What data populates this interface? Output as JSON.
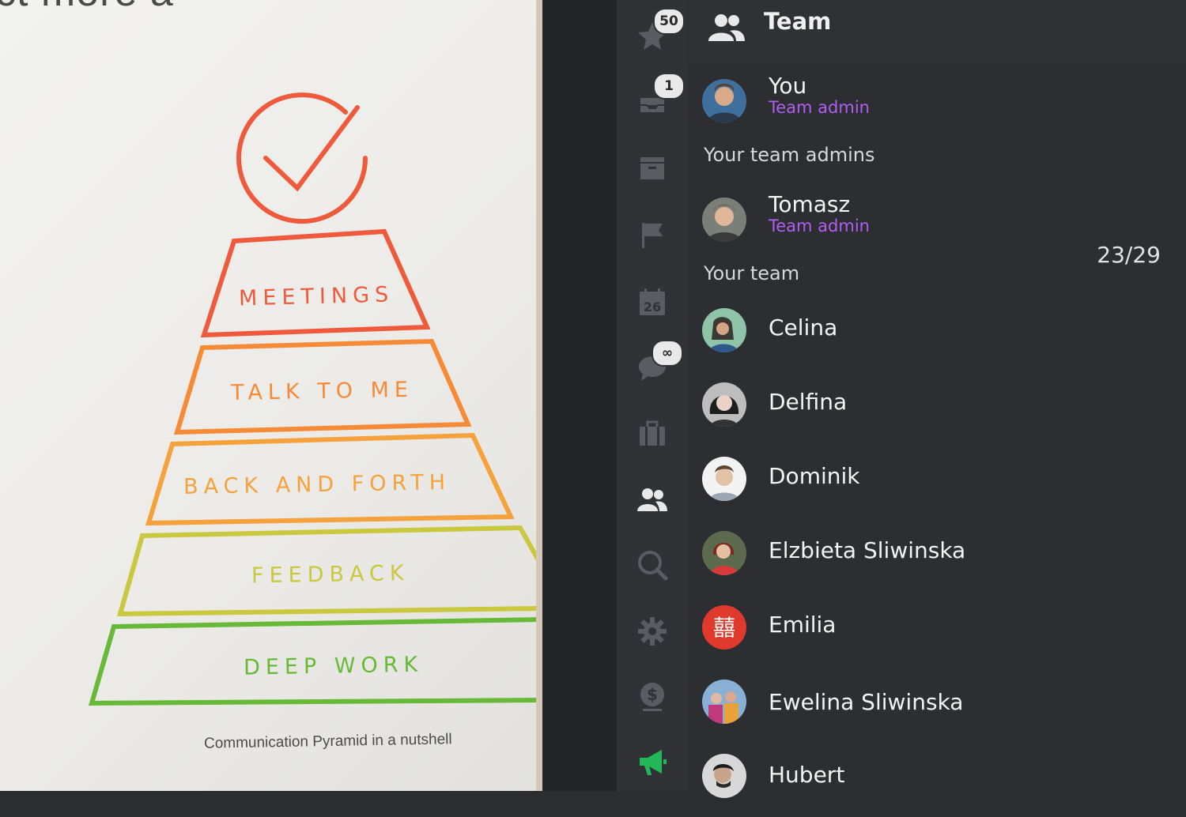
{
  "paper": {
    "top_text": "ct more a",
    "tiers": [
      "MEETINGS",
      "TALK TO ME",
      "BACK AND FORTH",
      "FEEDBACK",
      "DEEP WORK"
    ],
    "caption": "Communication Pyramid in a nutshell",
    "colors": {
      "check": "#ef5a3c",
      "meetings": "#ef5a3c",
      "talk": "#f68b37",
      "back_forth": "#f5a23d",
      "feedback": "#c9c83e",
      "deep_work": "#67b937"
    }
  },
  "rail": {
    "items": [
      {
        "icon": "star-icon",
        "badge": "50"
      },
      {
        "icon": "inbox-icon",
        "badge": "1"
      },
      {
        "icon": "archive-icon",
        "badge": ""
      },
      {
        "icon": "flag-icon",
        "badge": ""
      },
      {
        "icon": "calendar-icon",
        "badge": "",
        "text": "26"
      },
      {
        "icon": "chat-icon",
        "badge": "∞"
      },
      {
        "icon": "briefcase-icon",
        "badge": ""
      },
      {
        "icon": "team-icon",
        "badge": ""
      },
      {
        "icon": "search-icon",
        "badge": ""
      },
      {
        "icon": "gear-icon",
        "badge": ""
      },
      {
        "icon": "billing-icon",
        "badge": ""
      },
      {
        "icon": "megaphone-icon",
        "badge": ""
      }
    ],
    "active_color": "#e8e8e8",
    "megaphone_color": "#22b85a"
  },
  "panel": {
    "title": "Team",
    "you": {
      "name": "You",
      "role": "Team admin"
    },
    "admins_label": "Your team admins",
    "admins": [
      {
        "name": "Tomasz",
        "role": "Team admin"
      }
    ],
    "team_label": "Your team",
    "team_count": "23/29",
    "members": [
      "Celina",
      "Delfina",
      "Dominik",
      "Elzbieta Sliwinska",
      "Emilia",
      "Ewelina Sliwinska",
      "Hubert"
    ],
    "role_color": "#b15ff2"
  }
}
